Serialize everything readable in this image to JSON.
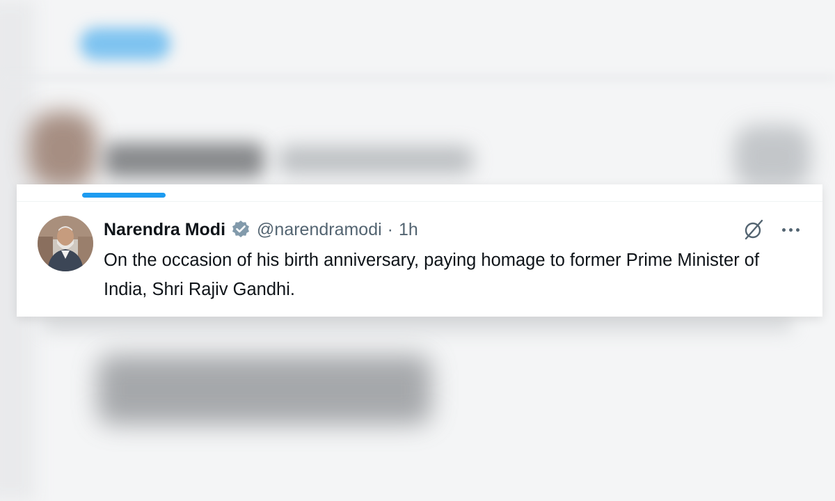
{
  "tweet": {
    "display_name": "Narendra Modi",
    "handle": "@narendramodi",
    "separator": "·",
    "timestamp": "1h",
    "text": "On the occasion of his birth anniversary, paying homage to former Prime Minister of India, Shri Rajiv Gandhi.",
    "verified_badge_color": "#829aab"
  },
  "icons": {
    "verified": "verified-badge-icon",
    "grok": "grok-icon",
    "more": "more-options-icon"
  },
  "colors": {
    "accent": "#1d9bf0",
    "text_primary": "#0f1419",
    "text_secondary": "#536471"
  }
}
